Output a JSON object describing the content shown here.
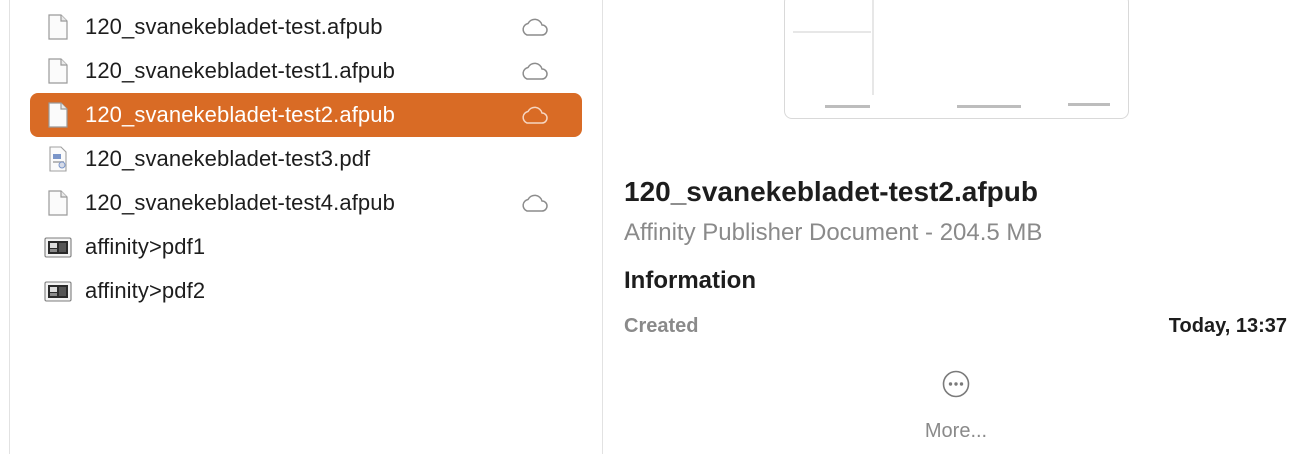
{
  "files": [
    {
      "name": "120_svanekebladet-test.afpub",
      "icon": "document-icon",
      "cloud": true,
      "selected": false
    },
    {
      "name": "120_svanekebladet-test1.afpub",
      "icon": "document-icon",
      "cloud": true,
      "selected": false
    },
    {
      "name": "120_svanekebladet-test2.afpub",
      "icon": "document-icon",
      "cloud": true,
      "selected": true
    },
    {
      "name": "120_svanekebladet-test3.pdf",
      "icon": "pdf-icon",
      "cloud": false,
      "selected": false
    },
    {
      "name": "120_svanekebladet-test4.afpub",
      "icon": "document-icon",
      "cloud": true,
      "selected": false
    },
    {
      "name": "affinity>pdf1",
      "icon": "alias-icon",
      "cloud": false,
      "selected": false
    },
    {
      "name": "affinity>pdf2",
      "icon": "alias-icon",
      "cloud": false,
      "selected": false
    }
  ],
  "details": {
    "filename": "120_svanekebladet-test2.afpub",
    "kind": "Affinity Publisher Document - 204.5 MB",
    "information_heading": "Information",
    "created_label": "Created",
    "created_value": "Today, 13:37",
    "more_label": "More..."
  },
  "colors": {
    "selection": "#d96b25",
    "text": "#1d1d1d",
    "secondary_text": "#8a8a8a"
  }
}
